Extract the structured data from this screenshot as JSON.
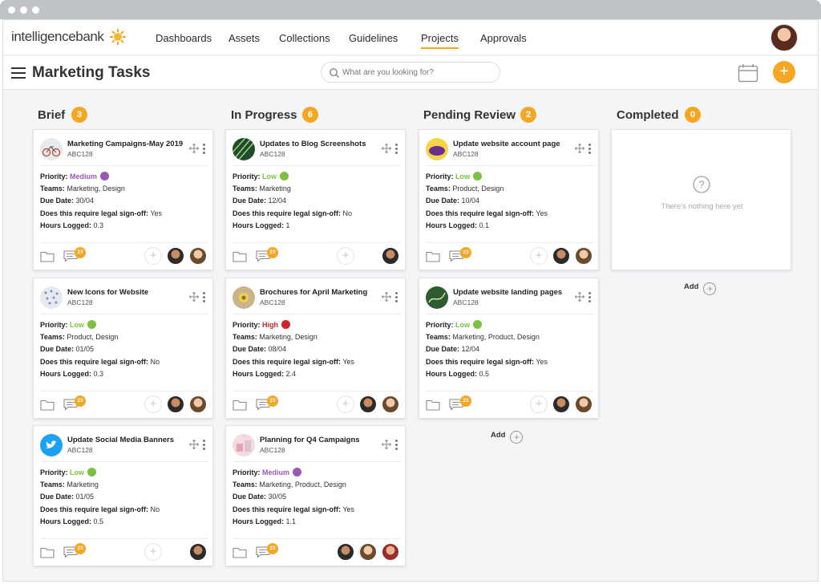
{
  "brand": {
    "logo_text": "intelligencebank",
    "accent": "#f5a623"
  },
  "nav": {
    "items": [
      "Dashboards",
      "Assets",
      "Collections",
      "Guidelines",
      "Projects",
      "Approvals"
    ],
    "active": "Projects"
  },
  "header": {
    "title": "Marketing Tasks",
    "search_placeholder": "What are you looking for?",
    "add_label": "+"
  },
  "columns": [
    {
      "title": "Brief",
      "count": "3",
      "add_label": "Add"
    },
    {
      "title": "In Progress",
      "count": "6",
      "add_label": "Add"
    },
    {
      "title": "Pending Review",
      "count": "2",
      "add_label": "Add"
    },
    {
      "title": "Completed",
      "count": "0",
      "add_label": "Add",
      "empty_text": "There's nothing here yet"
    }
  ],
  "labels": {
    "priority": "Priority:",
    "teams": "Teams:",
    "due": "Due Date:",
    "legal": "Does this require legal sign-off:",
    "hours": "Hours Logged:"
  },
  "priority_colors": {
    "Low": "#7cc242",
    "Medium": "#9b59b6",
    "High": "#d0232a"
  },
  "cards": [
    {
      "title": "Marketing Campaigns-May 2019",
      "code": "ABC128",
      "priority": "Medium",
      "teams": "Marketing, Design",
      "due": "30/04",
      "legal": "Yes",
      "hours": "0.3",
      "comments": "23",
      "thumb": "bike",
      "people": 2
    },
    {
      "title": "New Icons for Website",
      "code": "ABC128",
      "priority": "Low",
      "teams": "Product, Design",
      "due": "01/05",
      "legal": "No",
      "hours": "0.3",
      "comments": "23",
      "thumb": "icons",
      "people": 2
    },
    {
      "title": "Update Social Media Banners",
      "code": "ABC128",
      "priority": "Low",
      "teams": "Marketing",
      "due": "01/05",
      "legal": "No",
      "hours": "0.5",
      "comments": "23",
      "thumb": "twitter",
      "people": 1
    },
    {
      "title": "Updates to Blog Screenshots",
      "code": "ABC128",
      "priority": "Low",
      "teams": "Marketing",
      "due": "12/04",
      "legal": "No",
      "hours": "1",
      "comments": "23",
      "thumb": "leaf",
      "people": 1
    },
    {
      "title": "Brochures for April Marketing",
      "code": "ABC128",
      "priority": "High",
      "teams": "Marketing, Design",
      "due": "08/04",
      "legal": "Yes",
      "hours": "2.4",
      "comments": "23",
      "thumb": "flower",
      "people": 2
    },
    {
      "title": "Planning for Q4 Campaigns",
      "code": "ABC128",
      "priority": "Medium",
      "teams": "Marketing, Product, Design",
      "due": "30/05",
      "legal": "Yes",
      "hours": "1.1",
      "comments": "23",
      "thumb": "pastel",
      "people": 3
    },
    {
      "title": "Update website account page",
      "code": "ABC128",
      "priority": "Low",
      "teams": "Product, Design",
      "due": "10/04",
      "legal": "Yes",
      "hours": "0.1",
      "comments": "23",
      "thumb": "purple",
      "people": 2
    },
    {
      "title": "Update website landing pages",
      "code": "ABC128",
      "priority": "Low",
      "teams": "Marketing, Product, Design",
      "due": "12/04",
      "legal": "Yes",
      "hours": "0.5",
      "comments": "23",
      "thumb": "green",
      "people": 2
    }
  ]
}
